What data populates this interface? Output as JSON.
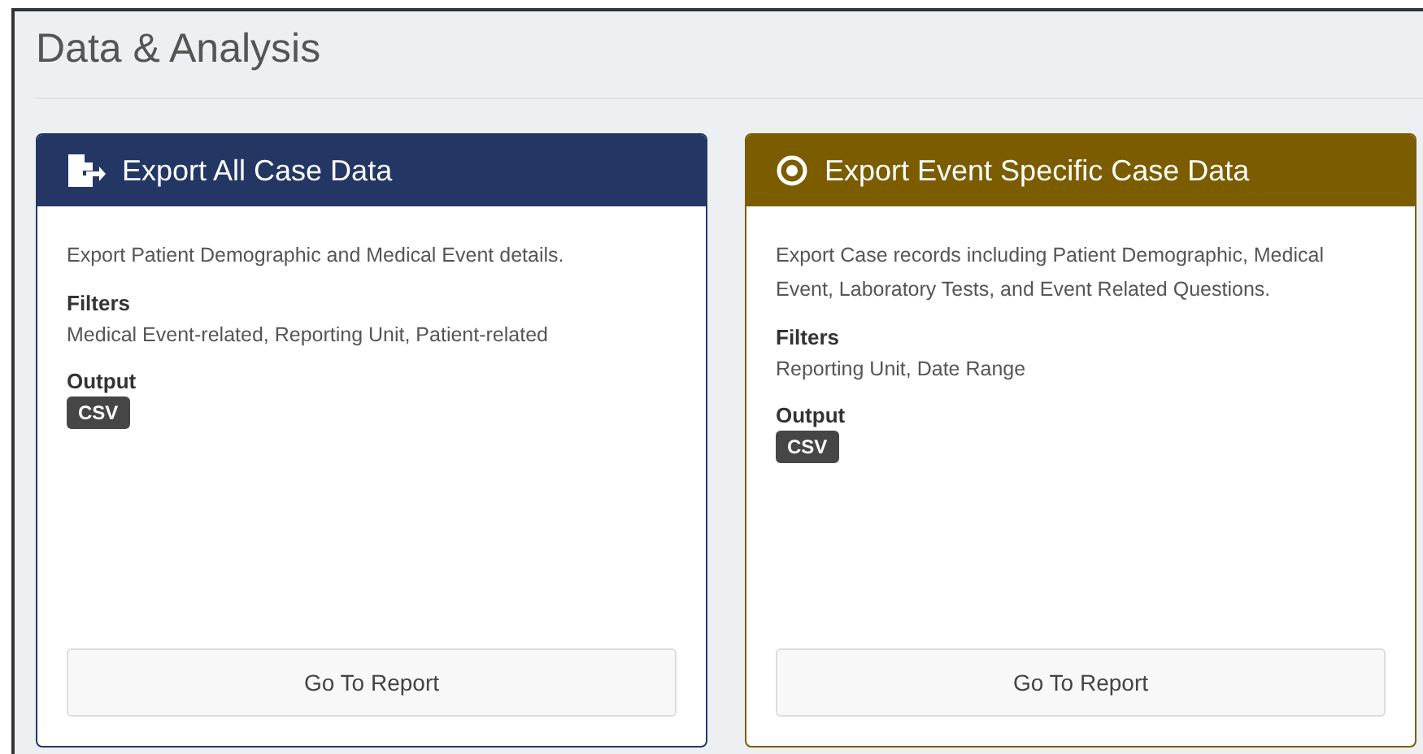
{
  "page": {
    "title": "Data & Analysis"
  },
  "cards": [
    {
      "kind": "export-file",
      "color": "#243764",
      "title": "Export All Case Data",
      "description": "Export Patient Demographic and Medical Event details.",
      "filters_label": "Filters",
      "filters": "Medical Event-related, Reporting Unit, Patient-related",
      "output_label": "Output",
      "output": "CSV",
      "button": "Go To Report"
    },
    {
      "kind": "target",
      "color": "#7b5d00",
      "title": "Export Event Specific Case Data",
      "description": "Export Case records including Patient Demographic, Medical Event, Laboratory Tests, and Event Related Questions.",
      "filters_label": "Filters",
      "filters": "Reporting Unit, Date Range",
      "output_label": "Output",
      "output": "CSV",
      "button": "Go To Report"
    }
  ]
}
